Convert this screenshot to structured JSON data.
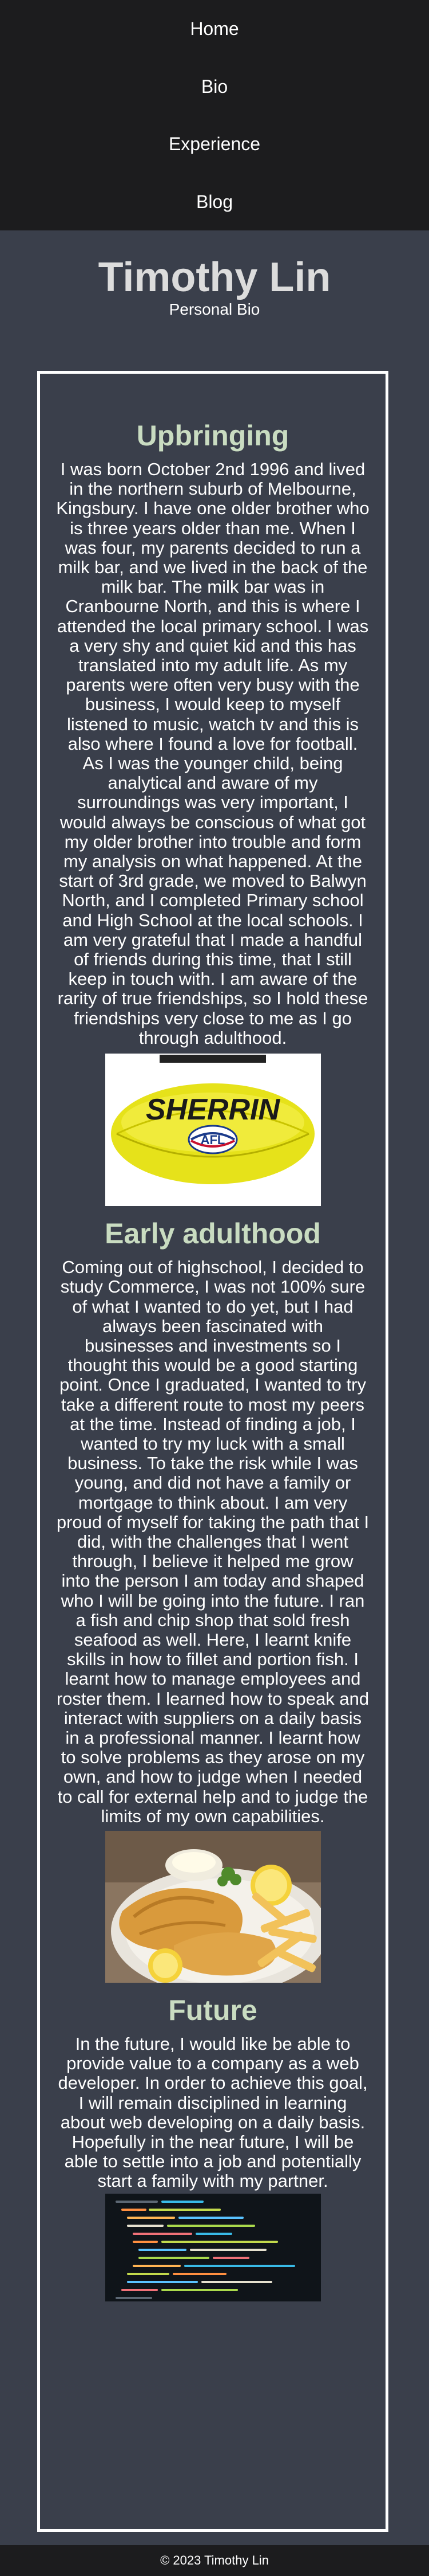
{
  "nav": {
    "items": [
      {
        "label": "Home"
      },
      {
        "label": "Bio"
      },
      {
        "label": "Experience"
      },
      {
        "label": "Blog"
      }
    ]
  },
  "header": {
    "title": "Timothy Lin",
    "subtitle": "Personal Bio"
  },
  "sections": [
    {
      "heading": "Upbringing",
      "text": "I was born October 2nd 1996 and lived in the northern suburb of Melbourne, Kingsbury. I have one older brother who is three years older than me. When I was four, my parents decided to run a milk bar, and we lived in the back of the milk bar. The milk bar was in Cranbourne North, and this is where I attended the local primary school. I was a very shy and quiet kid and this has translated into my adult life. As my parents were often very busy with the business, I would keep to myself listened to music, watch tv and this is also where I found a love for football. As I was the younger child, being analytical and aware of my surroundings was very important, I would always be conscious of what got my older brother into trouble and form my analysis on what happened. At the start of 3rd grade, we moved to Balwyn North, and I completed Primary school and High School at the local schools. I am very grateful that I made a handful of friends during this time, that I still keep in touch with. I am aware of the rarity of true friendships, so I hold these friendships very close to me as I go through adulthood.",
      "image": {
        "brand": "SHERRIN",
        "badge": "AFL"
      }
    },
    {
      "heading": "Early adulthood",
      "text": "Coming out of highschool, I decided to study Commerce, I was not 100% sure of what I wanted to do yet, but I had always been fascinated with businesses and investments so I thought this would be a good starting point. Once I graduated, I wanted to try take a different route to most my peers at the time. Instead of finding a job, I wanted to try my luck with a small business. To take the risk while I was young, and did not have a family or mortgage to think about. I am very proud of myself for taking the path that I did, with the challenges that I went through, I believe it helped me grow into the person I am today and shaped who I will be going into the future. I ran a fish and chip shop that sold fresh seafood as well. Here, I learnt knife skills in how to fillet and portion fish. I learnt how to manage employees and roster them. I learned how to speak and interact with suppliers on a daily basis in a professional manner. I learnt how to solve problems as they arose on my own, and how to judge when I needed to call for external help and to judge the limits of my own capabilities."
    },
    {
      "heading": "Future",
      "text": "In the future, I would like be able to provide value to a company as a web developer. In order to achieve this goal, I will remain disciplined in learning about web developing on a daily basis. Hopefully in the near future, I will be able to settle into a job and potentially start a family with my partner."
    }
  ],
  "footer": {
    "text": "© 2023 Timothy Lin"
  }
}
